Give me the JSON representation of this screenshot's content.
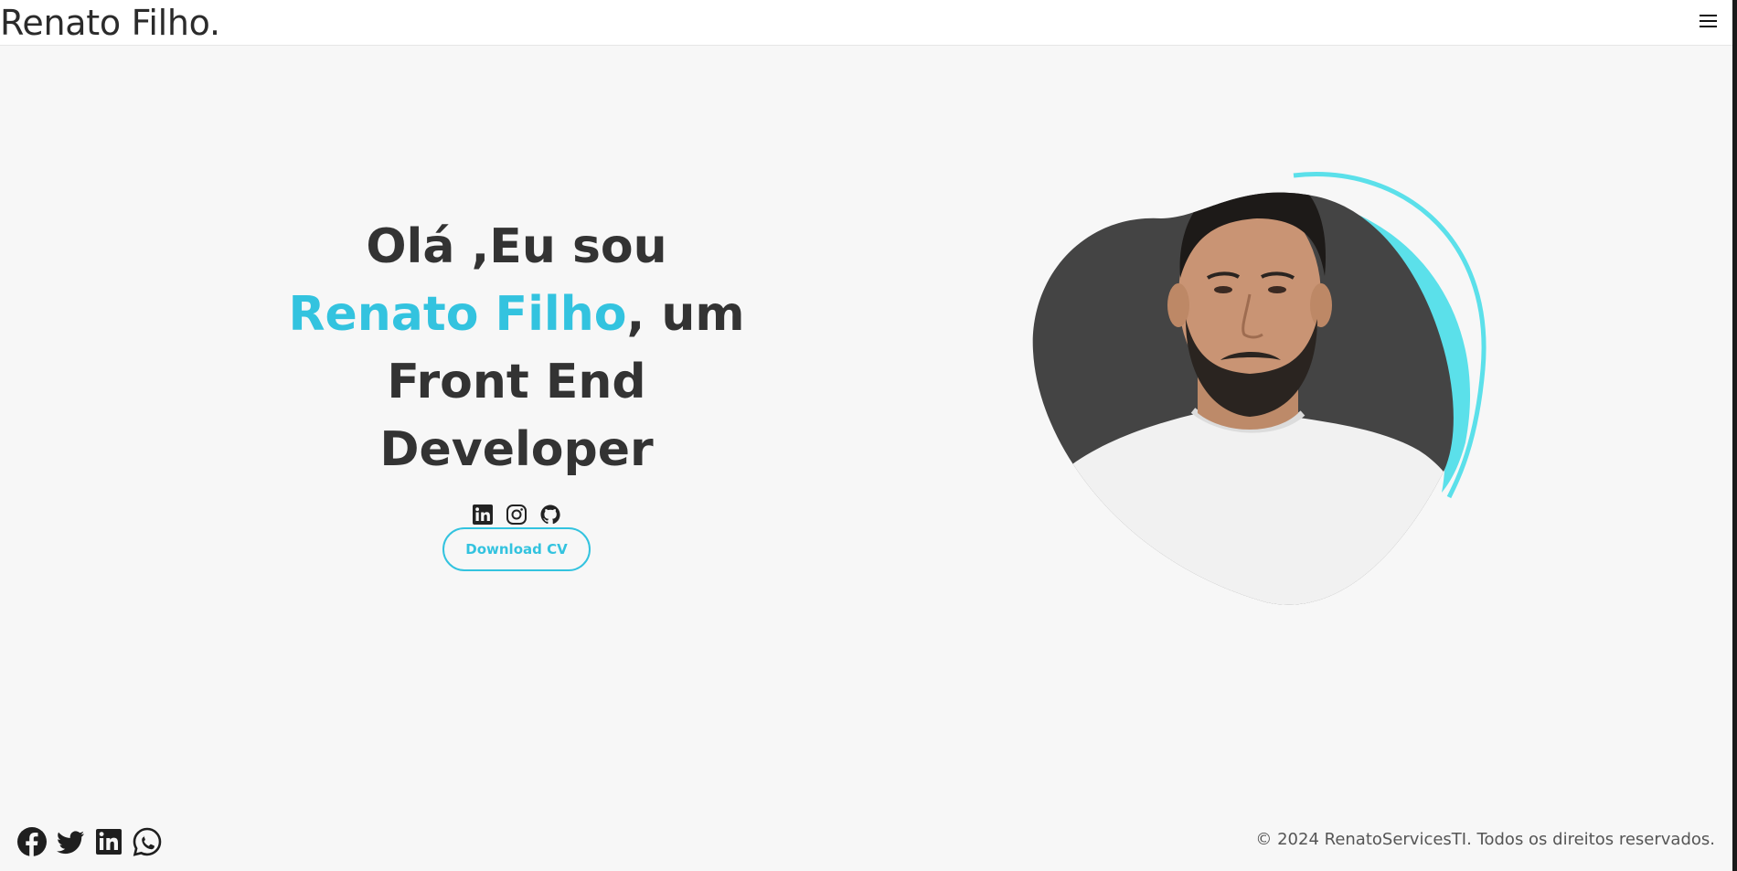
{
  "header": {
    "brand": "Renato Filho.",
    "menu_icon": "hamburger-menu-icon"
  },
  "hero": {
    "title_part1": "Olá ,Eu sou ",
    "name": "Renato Filho",
    "title_part2": ", um Front End Developer",
    "social_icons": [
      "linkedin-icon",
      "instagram-icon",
      "github-icon"
    ],
    "download_label": "Download CV",
    "accent_color": "#33c3df"
  },
  "footer": {
    "social_icons": [
      "facebook-icon",
      "twitter-icon",
      "linkedin-icon",
      "whatsapp-icon"
    ],
    "copyright": "© 2024 RenatoServicesTI. Todos os direitos reservados."
  }
}
